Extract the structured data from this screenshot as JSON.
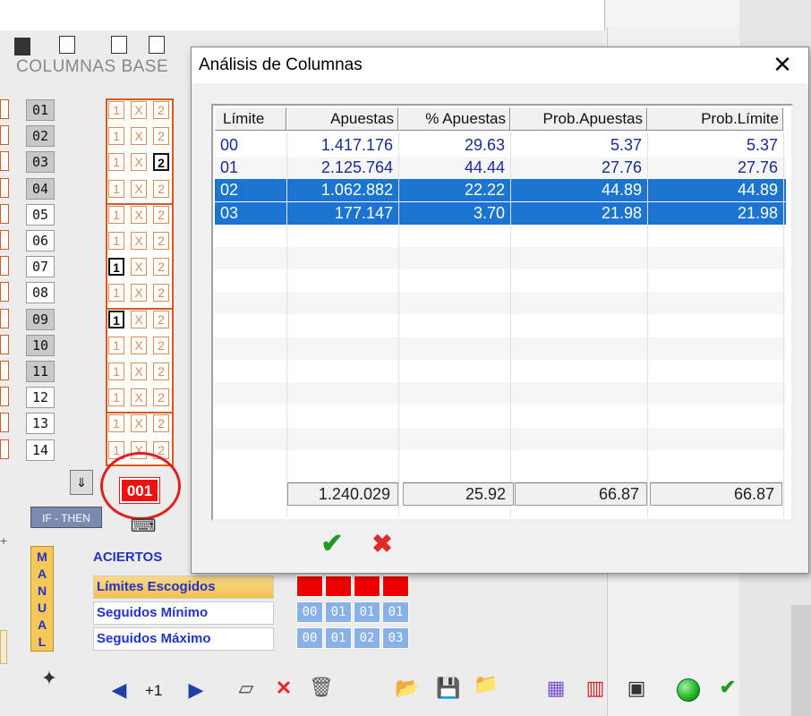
{
  "background": {
    "panel_title": "COLUMNAS BASE",
    "row_numbers": [
      "01",
      "02",
      "03",
      "04",
      "05",
      "06",
      "07",
      "08",
      "09",
      "10",
      "11",
      "12",
      "13",
      "14"
    ],
    "row_shades": [
      "dark",
      "dark",
      "dark",
      "dark",
      "light",
      "light",
      "light",
      "light",
      "dark",
      "dark",
      "dark",
      "light",
      "light",
      "light"
    ],
    "symbols": [
      "1",
      "X",
      "2"
    ],
    "selected": [
      [],
      [],
      [
        "2"
      ],
      [],
      [],
      [],
      [
        "1"
      ],
      [],
      [
        "1"
      ],
      [],
      [],
      [],
      [],
      []
    ],
    "column_badge": "001",
    "if_then_label": "IF - THEN",
    "manual_letters": [
      "M",
      "A",
      "N",
      "U",
      "A",
      "L"
    ],
    "aciertos_label": "ACIERTOS",
    "limits_label": "Límites Escogidos",
    "min_label": "Seguidos Mínimo",
    "max_label": "Seguidos Máximo",
    "min_values": [
      "00",
      "01",
      "01",
      "01"
    ],
    "max_values": [
      "00",
      "01",
      "02",
      "03"
    ],
    "step_label": "+1"
  },
  "dialog": {
    "title": "Análisis de Columnas",
    "close_glyph": "✕",
    "columns": [
      "Límite",
      "Apuestas",
      "% Apuestas",
      "Prob.Apuestas",
      "Prob.Límite"
    ],
    "rows": [
      {
        "limite": "00",
        "apuestas": "1.417.176",
        "pct": "29.63",
        "prob_apuestas": "5.37",
        "prob_limite": "5.37",
        "selected": false
      },
      {
        "limite": "01",
        "apuestas": "2.125.764",
        "pct": "44.44",
        "prob_apuestas": "27.76",
        "prob_limite": "27.76",
        "selected": false
      },
      {
        "limite": "02",
        "apuestas": "1.062.882",
        "pct": "22.22",
        "prob_apuestas": "44.89",
        "prob_limite": "44.89",
        "selected": true
      },
      {
        "limite": "03",
        "apuestas": "177.147",
        "pct": "3.70",
        "prob_apuestas": "21.98",
        "prob_limite": "21.98",
        "selected": true
      }
    ],
    "totals": {
      "apuestas": "1.240.029",
      "pct": "25.92",
      "prob_apuestas": "66.87",
      "prob_limite": "66.87"
    },
    "ok_glyph": "✔",
    "cancel_glyph": "✖"
  },
  "colors": {
    "selection": "#1a74d0",
    "accent_orange": "#d9581e",
    "badge_red": "#e11111",
    "label_blue": "#2233cc"
  }
}
